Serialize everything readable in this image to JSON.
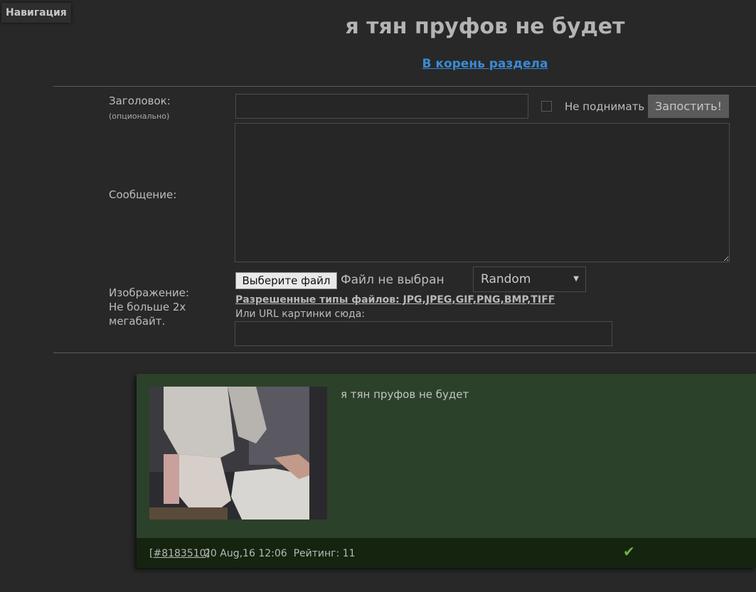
{
  "nav": {
    "label": "Навигация"
  },
  "thread": {
    "title": "я тян пруфов не будет",
    "root_link": "В корень раздела"
  },
  "form": {
    "subject_label": "Заголовок:",
    "subject_hint": "(опционально)",
    "subject_value": "",
    "no_bump_label": "Не поднимать",
    "submit_label": "Запостить!",
    "message_label": "Сообщение:",
    "message_value": "",
    "image_label_line1": "Изображение:",
    "image_label_line2": "Не больше 2х",
    "image_label_line3": "мегабайт.",
    "file_button_label": "Выберите файл",
    "file_status": "Файл не выбран",
    "select_value": "Random",
    "allowed_types": "Разрешенные типы файлов: JPG,JPEG,GIF,PNG,BMP,TIFF",
    "url_label": "Или URL картинки сюда:",
    "url_value": ""
  },
  "post": {
    "text": "я тян пруфов не будет",
    "number": "[#8183510]",
    "date": "20 Aug,16 12:06",
    "rating_label": "Рейтинг:",
    "rating_value": "11",
    "check_icon": "check-icon"
  },
  "colors": {
    "background": "#282828",
    "post_background": "#2c4129",
    "post_footer": "#14240f",
    "link": "#3a8bd8",
    "check": "#6db33f"
  }
}
